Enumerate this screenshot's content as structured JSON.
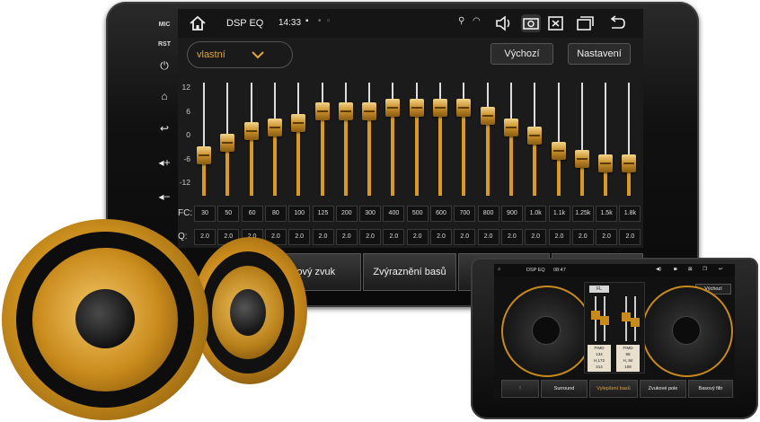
{
  "side": {
    "mic": "MIC",
    "rst": "RST"
  },
  "statusbar": {
    "title": "DSP EQ",
    "time": "14:33"
  },
  "eq": {
    "preset": "vlastní",
    "default_label": "Výchozí",
    "settings_label": "Nastavení",
    "y_labels": [
      "12",
      "6",
      "0",
      "-6",
      "-12"
    ],
    "fc_label": "FC:",
    "q_label": "Q:",
    "range": [
      -12,
      12
    ],
    "bands": [
      {
        "fc": "30",
        "q": "2.0",
        "gain": -4
      },
      {
        "fc": "50",
        "q": "2.0",
        "gain": -1
      },
      {
        "fc": "60",
        "q": "2.0",
        "gain": 2
      },
      {
        "fc": "80",
        "q": "2.0",
        "gain": 3
      },
      {
        "fc": "100",
        "q": "2.0",
        "gain": 4
      },
      {
        "fc": "125",
        "q": "2.0",
        "gain": 7
      },
      {
        "fc": "200",
        "q": "2.0",
        "gain": 7
      },
      {
        "fc": "300",
        "q": "2.0",
        "gain": 7
      },
      {
        "fc": "400",
        "q": "2.0",
        "gain": 8
      },
      {
        "fc": "500",
        "q": "2.0",
        "gain": 8
      },
      {
        "fc": "600",
        "q": "2.0",
        "gain": 8
      },
      {
        "fc": "700",
        "q": "2.0",
        "gain": 8
      },
      {
        "fc": "800",
        "q": "2.0",
        "gain": 6
      },
      {
        "fc": "900",
        "q": "2.0",
        "gain": 3
      },
      {
        "fc": "1.0k",
        "q": "2.0",
        "gain": 1
      },
      {
        "fc": "1.1k",
        "q": "2.0",
        "gain": -3
      },
      {
        "fc": "1.25k",
        "q": "2.0",
        "gain": -5
      },
      {
        "fc": "1.5k",
        "q": "2.0",
        "gain": -6
      },
      {
        "fc": "1.8k",
        "q": "2.0",
        "gain": -6
      }
    ],
    "accent": "#d89a25"
  },
  "tabs": {
    "surround": "Prostorový zvuk",
    "bass_boost": "Zvýraznění basů"
  },
  "device2": {
    "title": "DSP EQ",
    "time": "08:47",
    "default_label": "Výchozí",
    "fl_label": "FL",
    "readout_l": [
      "FIMD",
      "134",
      "H,172",
      "214"
    ],
    "readout_r": [
      "FIMD",
      "98",
      "H, 84",
      "108"
    ],
    "tabs": [
      "Surround",
      "Vylepšení basů",
      "Zvukové pole",
      "Basový filtr"
    ]
  }
}
